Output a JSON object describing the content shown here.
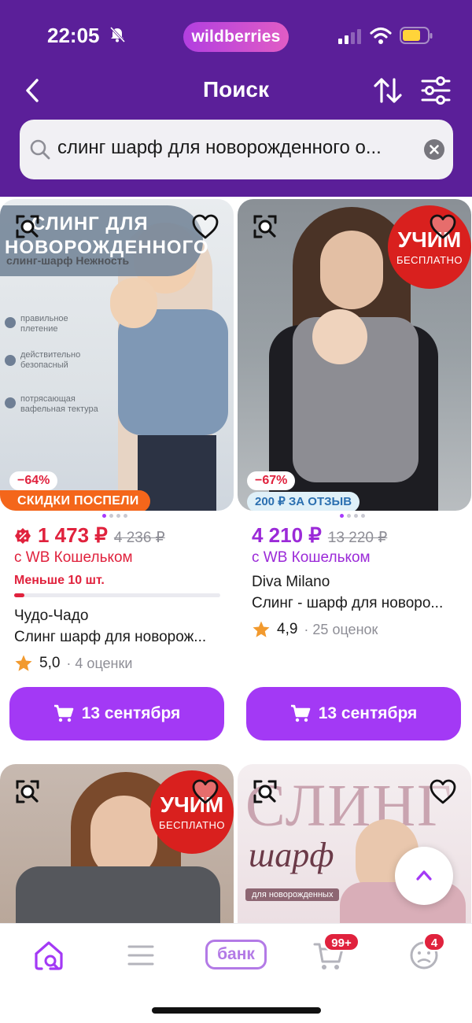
{
  "status_bar": {
    "time": "22:05",
    "brand": "wildberries"
  },
  "nav": {
    "title": "Поиск"
  },
  "search": {
    "query": "слинг шарф для новорожденного о..."
  },
  "products": [
    {
      "promo_title_1": "СЛИНГ ДЛЯ",
      "promo_title_2": "НОВОРОЖДЕННОГО",
      "promo_subtitle": "слинг-шарф Нежность",
      "features": [
        "правильное плетение",
        "действительно безопасный",
        "потрясающая вафельная тектура"
      ],
      "discount": "−64%",
      "tag": "СКИДКИ ПОСПЕЛИ",
      "price": "1 473 ₽",
      "old_price": "4 236 ₽",
      "wallet": "с WB Кошельком",
      "stock": "Меньше 10 шт.",
      "stock_level": 0.05,
      "brand": "Чудо-Чадо",
      "name": "Слинг шарф для новорож...",
      "rating": "5,0",
      "rating_count": "· 4 оценки",
      "delivery": "13 сентября"
    },
    {
      "badge_1": "УЧИМ",
      "badge_2": "БЕСПЛАТНО",
      "discount": "−67%",
      "tag": "200 ₽ ЗА ОТЗЫВ",
      "price": "4 210 ₽",
      "old_price": "13 220 ₽",
      "wallet": "с WB Кошельком",
      "brand": "Diva Milano",
      "name": "Слинг - шарф для новоро...",
      "rating": "4,9",
      "rating_count": "· 25 оценок",
      "delivery": "13 сентября"
    },
    {
      "badge_1": "УЧИМ",
      "badge_2": "БЕСПЛАТНО"
    },
    {
      "title": "СЛИНГ",
      "subtitle": "шарф",
      "caption": "для новорожденных"
    }
  ],
  "tabbar": {
    "bank_label": "банк",
    "cart_count": "99+",
    "profile_count": "4"
  },
  "colors": {
    "header": "#5b1f99",
    "accent": "#a339f5",
    "price_red": "#e0223d",
    "price_purple": "#9b2ad8",
    "tag_orange": "#f4661b"
  }
}
